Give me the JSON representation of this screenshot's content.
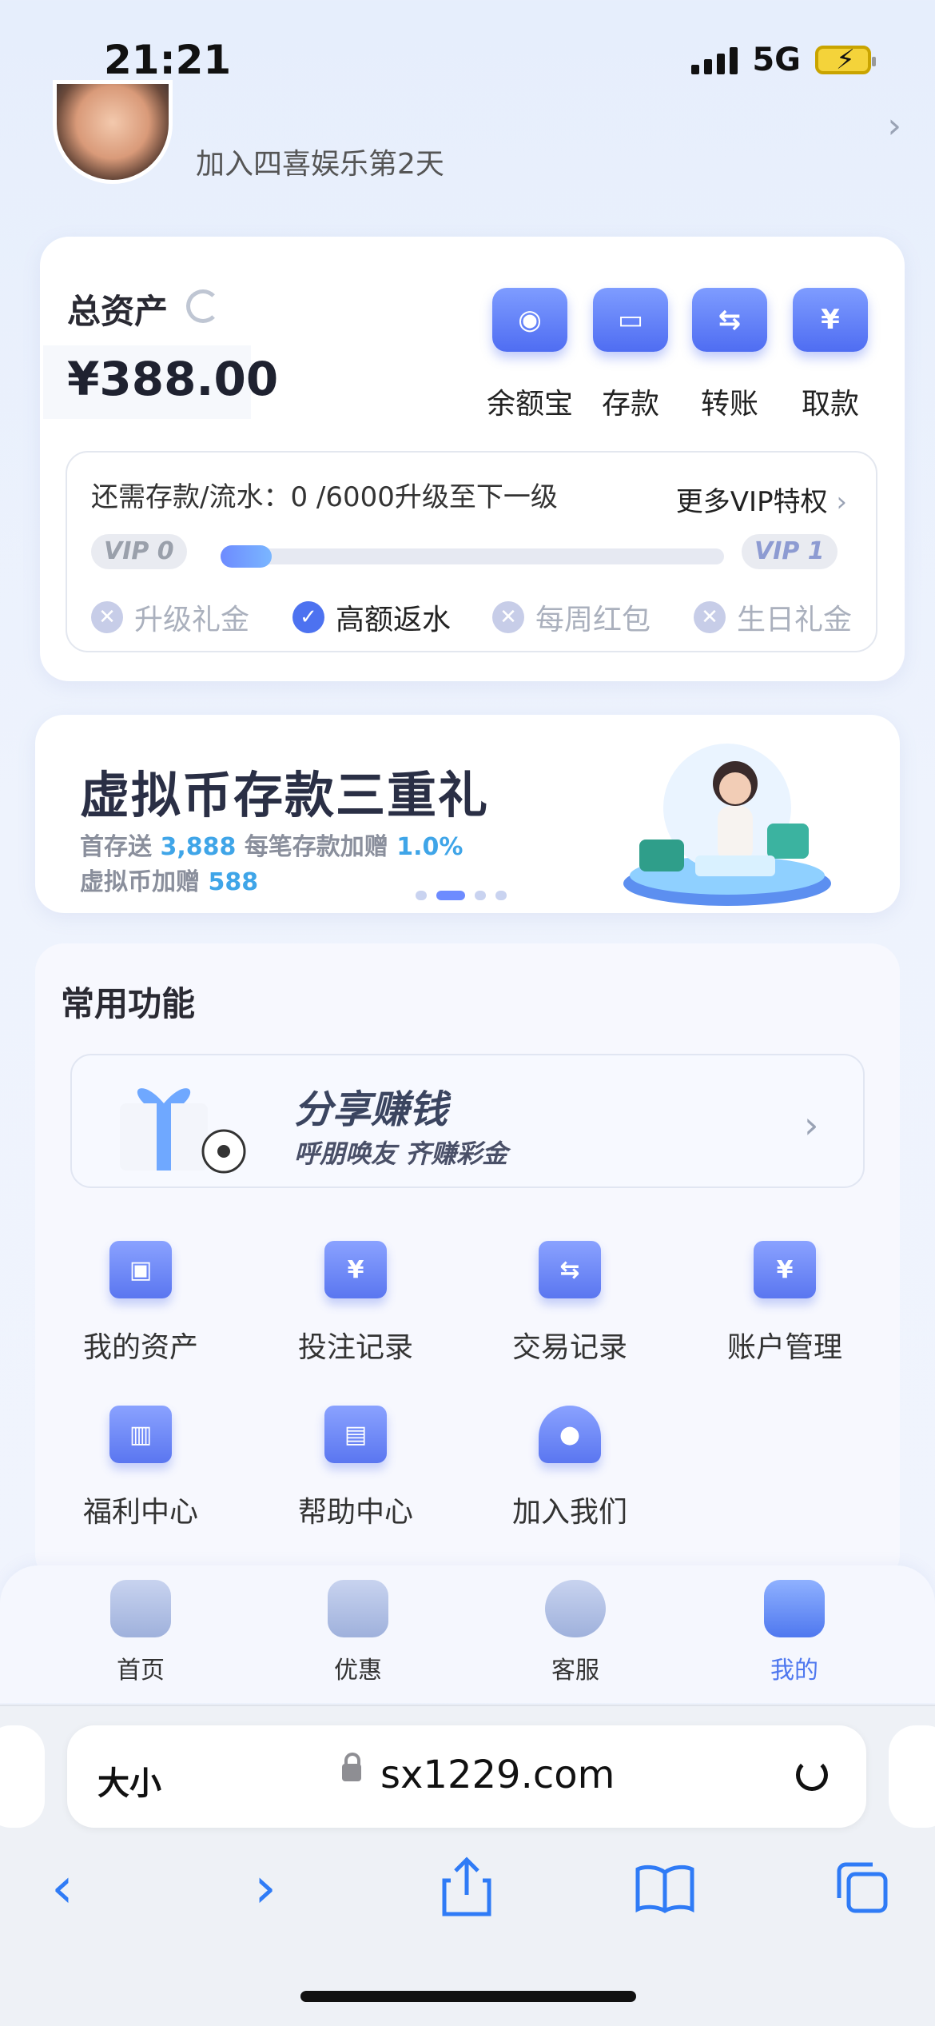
{
  "status": {
    "time": "21:21",
    "network": "5G"
  },
  "profile": {
    "join_text": "加入四喜娱乐第2天"
  },
  "assets": {
    "title": "总资产",
    "amount": "¥388.00",
    "actions": [
      {
        "label": "余额宝",
        "icon": "coin-stack-icon"
      },
      {
        "label": "存款",
        "icon": "wallet-icon"
      },
      {
        "label": "转账",
        "icon": "transfer-icon"
      },
      {
        "label": "取款",
        "icon": "withdraw-icon"
      }
    ]
  },
  "vip": {
    "need_text": "还需存款/流水：0 /6000升级至下一级",
    "more_text": "更多VIP特权",
    "current": "VIP 0",
    "next": "VIP 1",
    "progress": 0,
    "perks": [
      {
        "label": "升级礼金",
        "enabled": false
      },
      {
        "label": "高额返水",
        "enabled": true
      },
      {
        "label": "每周红包",
        "enabled": false
      },
      {
        "label": "生日礼金",
        "enabled": false
      }
    ]
  },
  "banner": {
    "title": "虚拟币存款三重礼",
    "line1_a": "首存送",
    "line1_b": "3,888",
    "line1_c": "每笔存款加赠",
    "line1_d": "1.0%",
    "line2_a": "虚拟币加赠",
    "line2_b": "588"
  },
  "features": {
    "title": "常用功能",
    "share_title": "分享赚钱",
    "share_sub": "呼朋唤友 齐赚彩金",
    "items": [
      {
        "label": "我的资产",
        "icon": "wallet-icon"
      },
      {
        "label": "投注记录",
        "icon": "yen-box-icon"
      },
      {
        "label": "交易记录",
        "icon": "clipboard-transfer-icon"
      },
      {
        "label": "账户管理",
        "icon": "folder-yen-icon"
      },
      {
        "label": "福利中心",
        "icon": "gift-box-icon"
      },
      {
        "label": "帮助中心",
        "icon": "book-icon"
      },
      {
        "label": "加入我们",
        "icon": "people-icon"
      }
    ]
  },
  "tabs": [
    {
      "label": "首页",
      "icon": "home-icon"
    },
    {
      "label": "优惠",
      "icon": "promo-icon"
    },
    {
      "label": "客服",
      "icon": "headset-icon"
    },
    {
      "label": "我的",
      "icon": "profile-icon",
      "active": true
    }
  ],
  "browser": {
    "text_size": "大小",
    "url": "sx1229.com"
  },
  "colors": {
    "accent": "#4f78ef",
    "highlight": "#3fa5e8"
  }
}
